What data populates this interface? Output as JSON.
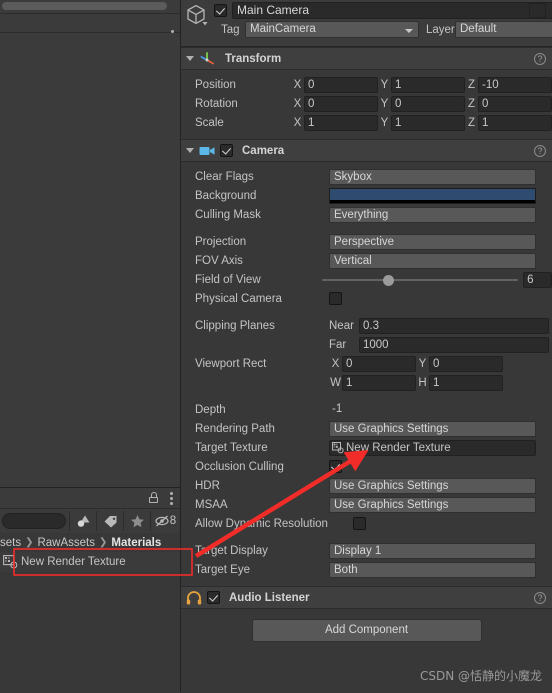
{
  "colors": {
    "panel_bg": "#383838",
    "field_bg": "#2a2a2a",
    "popup_bg": "#585858",
    "camera_background_color": "#2F4B70",
    "annotation_red": "#F22C28",
    "camera_icon_blue": "#5BB8E8",
    "audio_icon_orange": "#E8A33D"
  },
  "hierarchy_panel": {
    "name": "hierarchy-panel",
    "kebab_icon": "kebab-menu-icon",
    "scrollbar": "horizontal-scrollbar"
  },
  "project_panel": {
    "lock_icon": "lock-icon",
    "kebab_icon": "kebab-menu-icon",
    "search_placeholder": "",
    "search_value": "",
    "filters": [
      {
        "name": "filter-by-type",
        "icon": "asset-type-icon"
      },
      {
        "name": "filter-by-label",
        "icon": "label-tag-icon"
      },
      {
        "name": "filter-favorites",
        "icon": "star-icon"
      },
      {
        "name": "hidden-assets-toggle",
        "icon": "eye-slash-icon",
        "count": "8"
      }
    ],
    "breadcrumb": [
      "sets",
      "RawAssets",
      "Materials"
    ],
    "asset": {
      "icon": "render-texture-icon",
      "label": "New Render Texture"
    }
  },
  "inspector": {
    "gameobject": {
      "icon": "gameobject-cube-icon",
      "active": true,
      "name": "Main Camera",
      "static_label": "",
      "static_checked": false,
      "tag_label": "Tag",
      "tag_value": "MainCamera",
      "layer_label": "Layer",
      "layer_value": "Default"
    },
    "components": [
      {
        "name": "Transform",
        "icon": "transform-axis-icon",
        "expanded": true,
        "enabled_checkbox": false,
        "help_icon": "help-icon",
        "rows": [
          {
            "label": "Position",
            "x": "0",
            "y": "1",
            "z": "-10"
          },
          {
            "label": "Rotation",
            "x": "0",
            "y": "0",
            "z": "0"
          },
          {
            "label": "Scale",
            "x": "1",
            "y": "1",
            "z": "1"
          }
        ]
      },
      {
        "name": "Camera",
        "icon": "camera-icon",
        "expanded": true,
        "enabled_checkbox": true,
        "help_icon": "help-icon",
        "props": {
          "clear_flags": {
            "label": "Clear Flags",
            "value": "Skybox"
          },
          "background": {
            "label": "Background",
            "value": "#2F4B70"
          },
          "culling_mask": {
            "label": "Culling Mask",
            "value": "Everything"
          },
          "projection": {
            "label": "Projection",
            "value": "Perspective"
          },
          "fov_axis": {
            "label": "FOV Axis",
            "value": "Vertical"
          },
          "field_of_view": {
            "label": "Field of View",
            "value": "6",
            "slider_percent": 33
          },
          "physical_camera": {
            "label": "Physical Camera",
            "checked": false
          },
          "clipping_planes": {
            "label": "Clipping Planes",
            "near_label": "Near",
            "near_value": "0.3",
            "far_label": "Far",
            "far_value": "1000"
          },
          "viewport_rect": {
            "label": "Viewport Rect",
            "x": "0",
            "y": "0",
            "w": "1",
            "h": "1"
          },
          "depth": {
            "label": "Depth",
            "value": "-1"
          },
          "rendering_path": {
            "label": "Rendering Path",
            "value": "Use Graphics Settings"
          },
          "target_texture": {
            "label": "Target Texture",
            "value": "New Render Texture",
            "icon": "render-texture-icon"
          },
          "occlusion_culling": {
            "label": "Occlusion Culling",
            "checked": true
          },
          "hdr": {
            "label": "HDR",
            "value": "Use Graphics Settings"
          },
          "msaa": {
            "label": "MSAA",
            "value": "Use Graphics Settings"
          },
          "allow_dynamic_resolution": {
            "label": "Allow Dynamic Resolution",
            "checked": false
          },
          "target_display": {
            "label": "Target Display",
            "value": "Display 1"
          },
          "target_eye": {
            "label": "Target Eye",
            "value": "Both"
          }
        }
      },
      {
        "name": "Audio Listener",
        "icon": "headphones-icon",
        "expanded": false,
        "enabled_checkbox": true,
        "help_icon": "help-icon"
      }
    ],
    "add_component_label": "Add Component"
  },
  "watermark": "CSDN @恬静的小魔龙"
}
